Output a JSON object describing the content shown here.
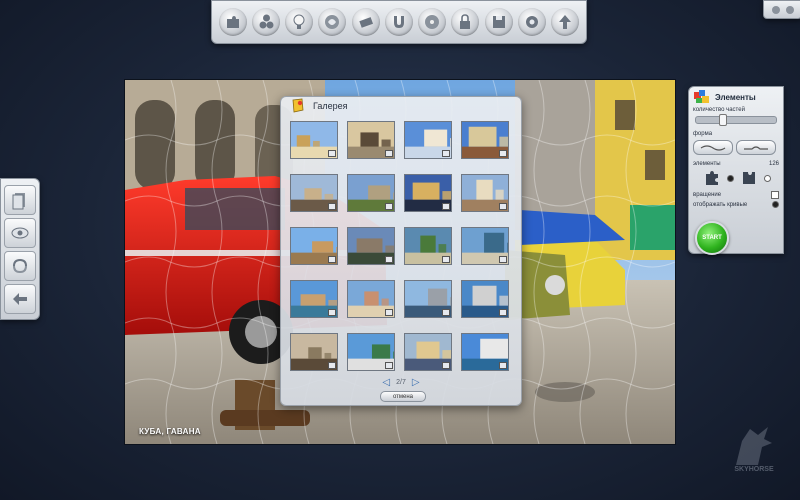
{
  "toolbar": {
    "top_icons": [
      "puzzle-pieces-icon",
      "molecules-icon",
      "lightbulb-icon",
      "swirl-icon",
      "eraser-icon",
      "magnet-icon",
      "disc-icon",
      "lock-icon",
      "save-icon",
      "gear-icon",
      "up-arrow-icon"
    ],
    "left_icons": [
      "sheet-icon",
      "eye-icon",
      "cycle-icon",
      "back-arrow-icon"
    ]
  },
  "board": {
    "caption": "КУБА, ГАВАНА"
  },
  "gallery": {
    "title": "Галерея",
    "page": "2/7",
    "cancel_label": "отмена",
    "thumbnails": [
      {
        "name": "acropolis"
      },
      {
        "name": "wolf-statue"
      },
      {
        "name": "capitol"
      },
      {
        "name": "moscow"
      },
      {
        "name": "city-panorama"
      },
      {
        "name": "cathedral"
      },
      {
        "name": "tower-bridge"
      },
      {
        "name": "palace"
      },
      {
        "name": "colosseum"
      },
      {
        "name": "old-town"
      },
      {
        "name": "castle-garden"
      },
      {
        "name": "river-bridge"
      },
      {
        "name": "canal-city"
      },
      {
        "name": "harbor-town"
      },
      {
        "name": "skyline"
      },
      {
        "name": "coastal-city"
      },
      {
        "name": "amphitheater"
      },
      {
        "name": "tropical-city"
      },
      {
        "name": "tv-tower-city"
      },
      {
        "name": "marina"
      }
    ]
  },
  "elements_panel": {
    "title": "Элементы",
    "pieces_count_label": "количество частей",
    "pieces_level": 0.3,
    "shape_label": "форма",
    "elements_label": "элементы",
    "elements_count": "126",
    "rotation_label": "вращение",
    "show_curves_label": "отображать кривые",
    "start_label": "START"
  },
  "colors": {
    "accent": "#2fb31e",
    "background": "#1b2538"
  },
  "watermark": {
    "text": "SKYHORSE"
  }
}
